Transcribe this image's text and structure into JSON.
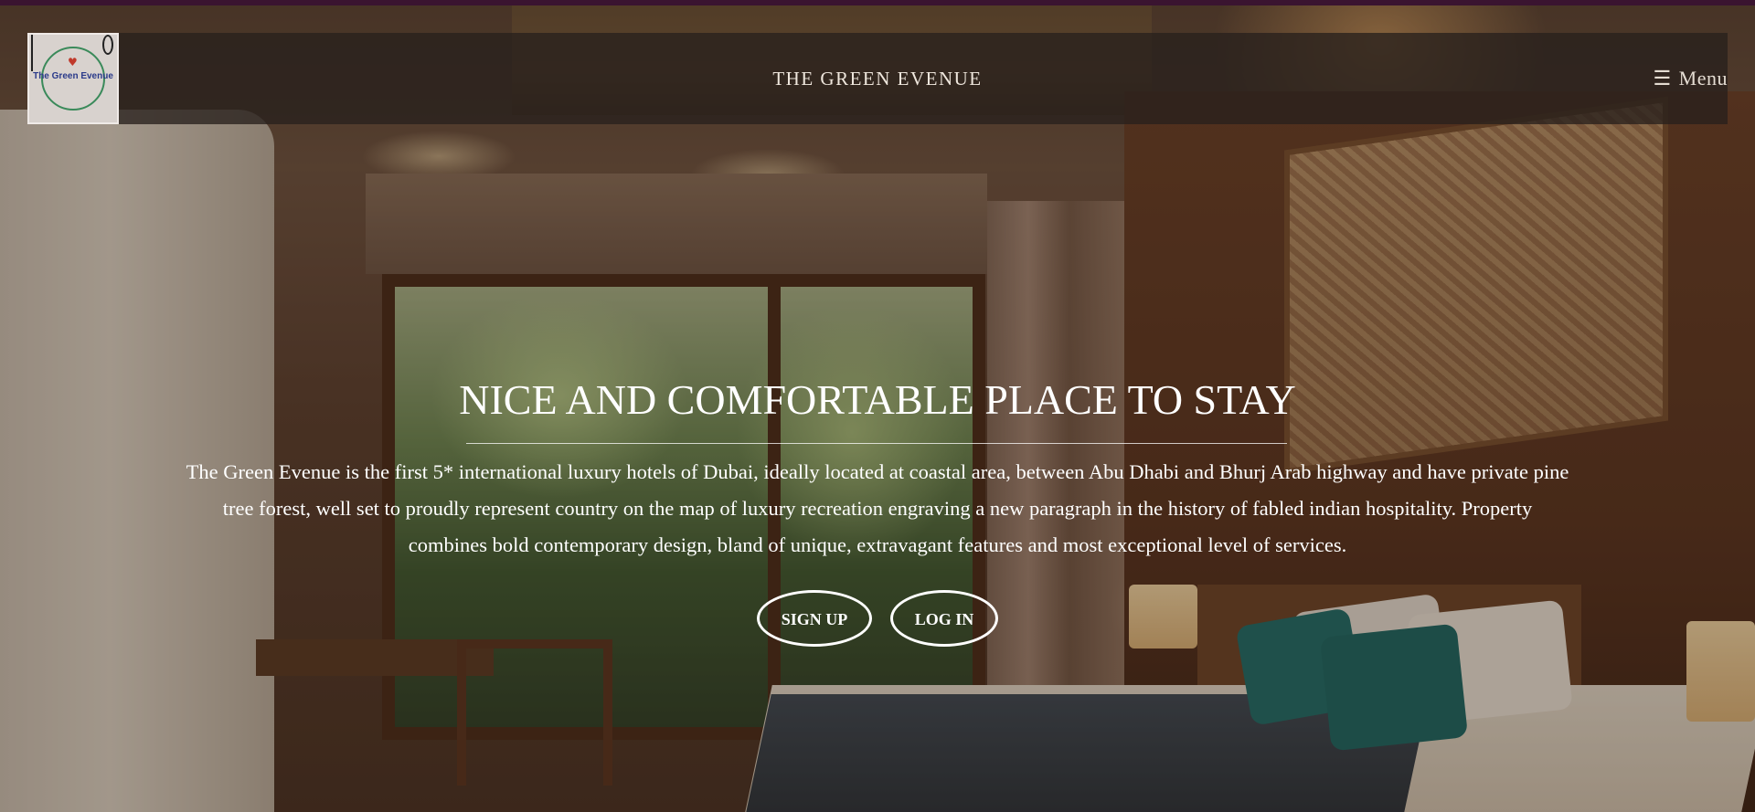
{
  "header": {
    "logo": {
      "text": "The Green Evenue",
      "heart_glyph": "♥",
      "icon_names": [
        "fork-icon",
        "knife-icon"
      ]
    },
    "site_title": "THE GREEN EVENUE",
    "menu": {
      "icon": "☰",
      "label": "Menu"
    }
  },
  "hero": {
    "heading": "NICE AND COMFORTABLE PLACE TO STAY",
    "description": "The Green Evenue is the first 5* international luxury hotels of Dubai, ideally located at coastal area, between Abu Dhabi and Bhurj Arab highway and have private pine tree forest, well set to proudly represent country on the map of luxury recreation engraving a new paragraph in the history of fabled indian hospitality. Property combines bold contemporary design, bland of unique, extravagant features and most exceptional level of services.",
    "buttons": {
      "signup": "SIGN UP",
      "login": "LOG IN"
    }
  },
  "colors": {
    "header_bg": "#28201c",
    "top_strip": "#3a1430",
    "text": "#ffffff",
    "logo_ring": "#3a8a5a",
    "logo_text": "#2a3a8a",
    "logo_heart": "#c0392b"
  }
}
